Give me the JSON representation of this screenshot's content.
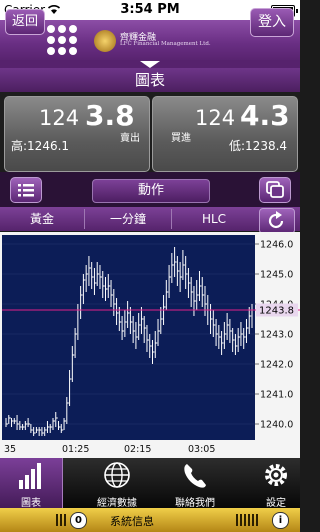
{
  "status_bar": {
    "carrier": "Carrier",
    "time": "3:54 PM"
  },
  "nav": {
    "back_label": "返回",
    "login_label": "登入",
    "logo_cn": "齊輝金融",
    "logo_en": "LFC Financial Management Ltd."
  },
  "page_title": "圖表",
  "quotes": {
    "sell": {
      "price_small": "124",
      "price_big": "3.8",
      "label": "賣出",
      "extreme_label": "高:1246.1"
    },
    "buy": {
      "price_small": "124",
      "price_big": "4.3",
      "label": "買進",
      "extreme_label": "低:1238.4"
    }
  },
  "toolbar": {
    "action_label": "動作"
  },
  "selectors": {
    "product": "黃金",
    "interval": "一分鐘",
    "chart_style": "HLC"
  },
  "tabs": [
    {
      "label": "圖表",
      "icon": "bar-chart-icon"
    },
    {
      "label": "經濟數據",
      "icon": "globe-icon"
    },
    {
      "label": "聯絡我們",
      "icon": "phone-icon"
    },
    {
      "label": "設定",
      "icon": "gear-icon"
    }
  ],
  "ticker": {
    "message": "系統信息",
    "pause_symbol": "0",
    "info_symbol": "i"
  },
  "colors": {
    "accent": "#6a2f84",
    "chart_bg": "#0c1d57",
    "price_line": "#e0218a",
    "last_price_box": "#e9d7ee"
  },
  "chart_data": {
    "type": "line",
    "style": "HLC",
    "x_ticks": [
      "35",
      "01:25",
      "02:15",
      "03:05"
    ],
    "y_ticks": [
      1240.0,
      1241.0,
      1242.0,
      1243.0,
      1244.0,
      1245.0,
      1246.0
    ],
    "ylim": [
      1239.6,
      1246.2
    ],
    "last_price": 1243.8,
    "last_price_label": "1243.8",
    "n_bars": 90,
    "bars": [
      {
        "h": 1240.2,
        "l": 1239.9,
        "c": 1240.0
      },
      {
        "h": 1240.3,
        "l": 1240.0,
        "c": 1240.2
      },
      {
        "h": 1240.2,
        "l": 1239.9,
        "c": 1240.1
      },
      {
        "h": 1240.2,
        "l": 1240.0,
        "c": 1240.1
      },
      {
        "h": 1240.3,
        "l": 1239.8,
        "c": 1240.0
      },
      {
        "h": 1240.1,
        "l": 1239.8,
        "c": 1239.9
      },
      {
        "h": 1240.0,
        "l": 1239.8,
        "c": 1239.9
      },
      {
        "h": 1240.1,
        "l": 1239.8,
        "c": 1240.0
      },
      {
        "h": 1240.2,
        "l": 1239.9,
        "c": 1240.0
      },
      {
        "h": 1240.0,
        "l": 1239.7,
        "c": 1239.8
      },
      {
        "h": 1239.9,
        "l": 1239.6,
        "c": 1239.7
      },
      {
        "h": 1239.9,
        "l": 1239.7,
        "c": 1239.8
      },
      {
        "h": 1239.9,
        "l": 1239.6,
        "c": 1239.8
      },
      {
        "h": 1239.9,
        "l": 1239.6,
        "c": 1239.7
      },
      {
        "h": 1239.9,
        "l": 1239.6,
        "c": 1239.8
      },
      {
        "h": 1240.1,
        "l": 1239.7,
        "c": 1239.9
      },
      {
        "h": 1240.0,
        "l": 1239.7,
        "c": 1239.9
      },
      {
        "h": 1240.2,
        "l": 1239.8,
        "c": 1240.1
      },
      {
        "h": 1240.4,
        "l": 1239.9,
        "c": 1240.2
      },
      {
        "h": 1240.1,
        "l": 1239.8,
        "c": 1239.9
      },
      {
        "h": 1240.0,
        "l": 1239.7,
        "c": 1239.8
      },
      {
        "h": 1240.2,
        "l": 1239.8,
        "c": 1240.1
      },
      {
        "h": 1240.9,
        "l": 1240.0,
        "c": 1240.7
      },
      {
        "h": 1241.8,
        "l": 1240.6,
        "c": 1241.5
      },
      {
        "h": 1242.6,
        "l": 1241.4,
        "c": 1242.3
      },
      {
        "h": 1243.2,
        "l": 1242.2,
        "c": 1243.0
      },
      {
        "h": 1244.0,
        "l": 1242.8,
        "c": 1243.8
      },
      {
        "h": 1244.6,
        "l": 1243.5,
        "c": 1244.3
      },
      {
        "h": 1245.0,
        "l": 1244.0,
        "c": 1244.8
      },
      {
        "h": 1245.3,
        "l": 1244.4,
        "c": 1245.0
      },
      {
        "h": 1245.6,
        "l": 1244.6,
        "c": 1245.2
      },
      {
        "h": 1245.4,
        "l": 1244.5,
        "c": 1244.9
      },
      {
        "h": 1245.2,
        "l": 1244.3,
        "c": 1244.7
      },
      {
        "h": 1245.4,
        "l": 1244.6,
        "c": 1245.0
      },
      {
        "h": 1245.3,
        "l": 1244.5,
        "c": 1244.9
      },
      {
        "h": 1245.1,
        "l": 1244.2,
        "c": 1244.6
      },
      {
        "h": 1244.9,
        "l": 1244.1,
        "c": 1244.5
      },
      {
        "h": 1245.0,
        "l": 1244.2,
        "c": 1244.6
      },
      {
        "h": 1244.8,
        "l": 1243.9,
        "c": 1244.3
      },
      {
        "h": 1244.5,
        "l": 1243.6,
        "c": 1244.0
      },
      {
        "h": 1244.2,
        "l": 1243.3,
        "c": 1243.7
      },
      {
        "h": 1243.9,
        "l": 1243.1,
        "c": 1243.4
      },
      {
        "h": 1243.6,
        "l": 1242.8,
        "c": 1243.1
      },
      {
        "h": 1243.8,
        "l": 1242.9,
        "c": 1243.4
      },
      {
        "h": 1244.1,
        "l": 1243.2,
        "c": 1243.7
      },
      {
        "h": 1243.9,
        "l": 1243.0,
        "c": 1243.4
      },
      {
        "h": 1243.6,
        "l": 1242.7,
        "c": 1243.1
      },
      {
        "h": 1243.4,
        "l": 1242.5,
        "c": 1242.9
      },
      {
        "h": 1243.7,
        "l": 1242.8,
        "c": 1243.3
      },
      {
        "h": 1243.9,
        "l": 1243.0,
        "c": 1243.5
      },
      {
        "h": 1243.6,
        "l": 1242.7,
        "c": 1243.2
      },
      {
        "h": 1243.3,
        "l": 1242.4,
        "c": 1242.8
      },
      {
        "h": 1243.0,
        "l": 1242.2,
        "c": 1242.6
      },
      {
        "h": 1242.8,
        "l": 1242.0,
        "c": 1242.4
      },
      {
        "h": 1243.1,
        "l": 1242.2,
        "c": 1242.7
      },
      {
        "h": 1243.5,
        "l": 1242.6,
        "c": 1243.1
      },
      {
        "h": 1243.9,
        "l": 1243.0,
        "c": 1243.5
      },
      {
        "h": 1244.3,
        "l": 1243.3,
        "c": 1243.9
      },
      {
        "h": 1244.8,
        "l": 1243.8,
        "c": 1244.4
      },
      {
        "h": 1245.3,
        "l": 1244.2,
        "c": 1244.9
      },
      {
        "h": 1245.7,
        "l": 1244.7,
        "c": 1245.3
      },
      {
        "h": 1245.9,
        "l": 1244.9,
        "c": 1245.4
      },
      {
        "h": 1245.6,
        "l": 1244.6,
        "c": 1245.1
      },
      {
        "h": 1245.4,
        "l": 1244.4,
        "c": 1244.9
      },
      {
        "h": 1245.8,
        "l": 1244.8,
        "c": 1245.3
      },
      {
        "h": 1245.6,
        "l": 1244.5,
        "c": 1245.0
      },
      {
        "h": 1245.2,
        "l": 1244.2,
        "c": 1244.7
      },
      {
        "h": 1244.9,
        "l": 1243.9,
        "c": 1244.4
      },
      {
        "h": 1244.6,
        "l": 1243.6,
        "c": 1244.1
      },
      {
        "h": 1244.8,
        "l": 1243.8,
        "c": 1244.3
      },
      {
        "h": 1245.1,
        "l": 1244.1,
        "c": 1244.6
      },
      {
        "h": 1244.9,
        "l": 1243.9,
        "c": 1244.3
      },
      {
        "h": 1244.6,
        "l": 1243.6,
        "c": 1244.0
      },
      {
        "h": 1244.3,
        "l": 1243.3,
        "c": 1243.8
      },
      {
        "h": 1244.0,
        "l": 1243.0,
        "c": 1243.5
      },
      {
        "h": 1243.8,
        "l": 1242.9,
        "c": 1243.3
      },
      {
        "h": 1243.5,
        "l": 1242.6,
        "c": 1243.0
      },
      {
        "h": 1243.3,
        "l": 1242.5,
        "c": 1242.9
      },
      {
        "h": 1243.1,
        "l": 1242.3,
        "c": 1242.7
      },
      {
        "h": 1243.4,
        "l": 1242.5,
        "c": 1243.0
      },
      {
        "h": 1243.7,
        "l": 1242.8,
        "c": 1243.3
      },
      {
        "h": 1243.5,
        "l": 1242.7,
        "c": 1243.1
      },
      {
        "h": 1243.2,
        "l": 1242.4,
        "c": 1242.8
      },
      {
        "h": 1243.0,
        "l": 1242.3,
        "c": 1242.6
      },
      {
        "h": 1243.2,
        "l": 1242.4,
        "c": 1242.9
      },
      {
        "h": 1243.4,
        "l": 1242.6,
        "c": 1243.0
      },
      {
        "h": 1243.2,
        "l": 1242.5,
        "c": 1242.9
      },
      {
        "h": 1243.5,
        "l": 1242.7,
        "c": 1243.2
      },
      {
        "h": 1243.9,
        "l": 1243.0,
        "c": 1243.6
      },
      {
        "h": 1244.0,
        "l": 1243.2,
        "c": 1243.8
      }
    ]
  }
}
